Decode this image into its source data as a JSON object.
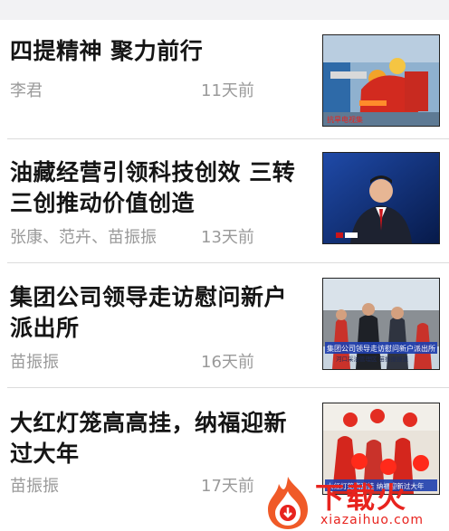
{
  "articles": [
    {
      "title": "四提精神 聚力前行",
      "author": "李君",
      "time": "11天前",
      "thumb_caption": "抗旱电视集"
    },
    {
      "title": "油藏经营引领科技创效 三转三创推动价值创造",
      "author": "张康、范卉、苗振振",
      "time": "13天前",
      "thumb_caption": ""
    },
    {
      "title": "集团公司领导走访慰问新户派出所",
      "author": "苗振振",
      "time": "16天前",
      "thumb_caption": "集团公司领导走访慰问新户派出所",
      "thumb_subcaption": "河口采油管理区  苗振振报道"
    },
    {
      "title": "大红灯笼高高挂，纳福迎新过大年",
      "author": "苗振振",
      "time": "17天前",
      "thumb_caption": "大红灯笼高高挂 纳福迎新过大年"
    }
  ],
  "watermark": {
    "brand": "下载火",
    "domain": "xiazaihuo.com"
  },
  "colors": {
    "title": "#151515",
    "meta": "#9a9a9a",
    "watermark": "#e8231e"
  }
}
